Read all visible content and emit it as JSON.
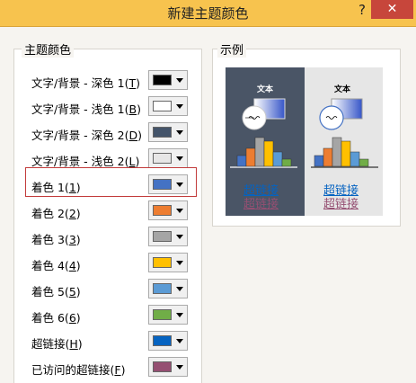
{
  "window": {
    "title": "新建主题颜色",
    "help_label": "?",
    "close_label": "✕"
  },
  "theme_colors": {
    "label": "主题颜色",
    "items": [
      {
        "text": "文字/背景 - 深色 1(",
        "key": "T",
        "tail": ")",
        "color": "#000000"
      },
      {
        "text": "文字/背景 - 浅色 1(",
        "key": "B",
        "tail": ")",
        "color": "#ffffff"
      },
      {
        "text": "文字/背景 - 深色 2(",
        "key": "D",
        "tail": ")",
        "color": "#44546a"
      },
      {
        "text": "文字/背景 - 浅色 2(",
        "key": "L",
        "tail": ")",
        "color": "#e7e6e6"
      },
      {
        "text": "着色 1(",
        "key": "1",
        "tail": ")",
        "color": "#4472c4"
      },
      {
        "text": "着色 2(",
        "key": "2",
        "tail": ")",
        "color": "#ed7d31"
      },
      {
        "text": "着色 3(",
        "key": "3",
        "tail": ")",
        "color": "#a5a5a5"
      },
      {
        "text": "着色 4(",
        "key": "4",
        "tail": ")",
        "color": "#ffc000"
      },
      {
        "text": "着色 5(",
        "key": "5",
        "tail": ")",
        "color": "#5b9bd5"
      },
      {
        "text": "着色 6(",
        "key": "6",
        "tail": ")",
        "color": "#70ad47"
      },
      {
        "text": "超链接(",
        "key": "H",
        "tail": ")",
        "color": "#0563c1"
      },
      {
        "text": "已访问的超链接(",
        "key": "F",
        "tail": ")",
        "color": "#954f72"
      }
    ]
  },
  "sample": {
    "label": "示例",
    "dark_text": "文本",
    "light_text": "文本",
    "hyperlink": "超链接",
    "visited_hyperlink": "超链接",
    "bar_colors": [
      "#4472c4",
      "#ed7d31",
      "#a5a5a5",
      "#ffc000",
      "#5b9bd5",
      "#70ad47"
    ],
    "bar_values": [
      3,
      5,
      8,
      7,
      4,
      2
    ]
  }
}
